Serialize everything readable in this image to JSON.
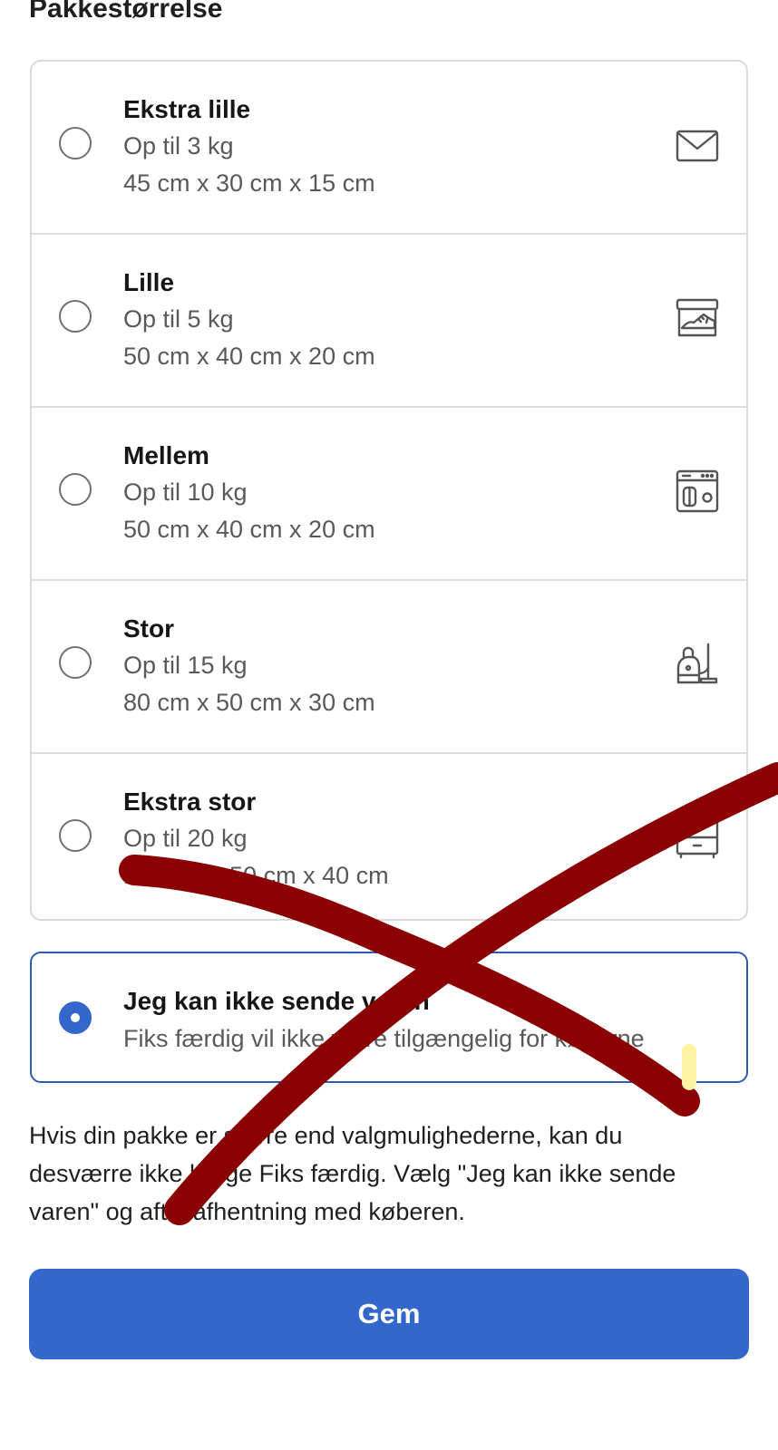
{
  "page": {
    "title": "Pakkestørrelse"
  },
  "options": [
    {
      "title": "Ekstra lille",
      "weight": "Op til 3 kg",
      "dimensions": "45 cm x 30 cm x 15 cm",
      "icon": "envelope-icon",
      "selected": false
    },
    {
      "title": "Lille",
      "weight": "Op til 5 kg",
      "dimensions": "50 cm x 40 cm x 20 cm",
      "icon": "shoebox-icon",
      "selected": false
    },
    {
      "title": "Mellem",
      "weight": "Op til 10 kg",
      "dimensions": "50 cm x 40 cm x 20 cm",
      "icon": "appliance-icon",
      "selected": false
    },
    {
      "title": "Stor",
      "weight": "Op til 15 kg",
      "dimensions": "80 cm x 50 cm x 30 cm",
      "icon": "vacuum-cleaner-icon",
      "selected": false
    },
    {
      "title": "Ekstra stor",
      "weight": "Op til 20 kg",
      "dimensions": "100 cm x 50 cm x 40 cm",
      "icon": "drawer-icon",
      "selected": false
    }
  ],
  "cannot_send": {
    "title": "Jeg kan ikke sende varen",
    "description": "Fiks færdig vil ikke være tilgængelig for køberne",
    "selected": true
  },
  "info_text": "Hvis din pakke er større end valgmulighederne, kan du desværre ikke bruge Fiks færdig. Vælg \"Jeg kan ikke sende varen\" og aftal afhentning med køberen.",
  "save_button": {
    "label": "Gem"
  },
  "colors": {
    "accent": "#3367cc",
    "annotation": "#8b0000",
    "border": "#dadada"
  }
}
